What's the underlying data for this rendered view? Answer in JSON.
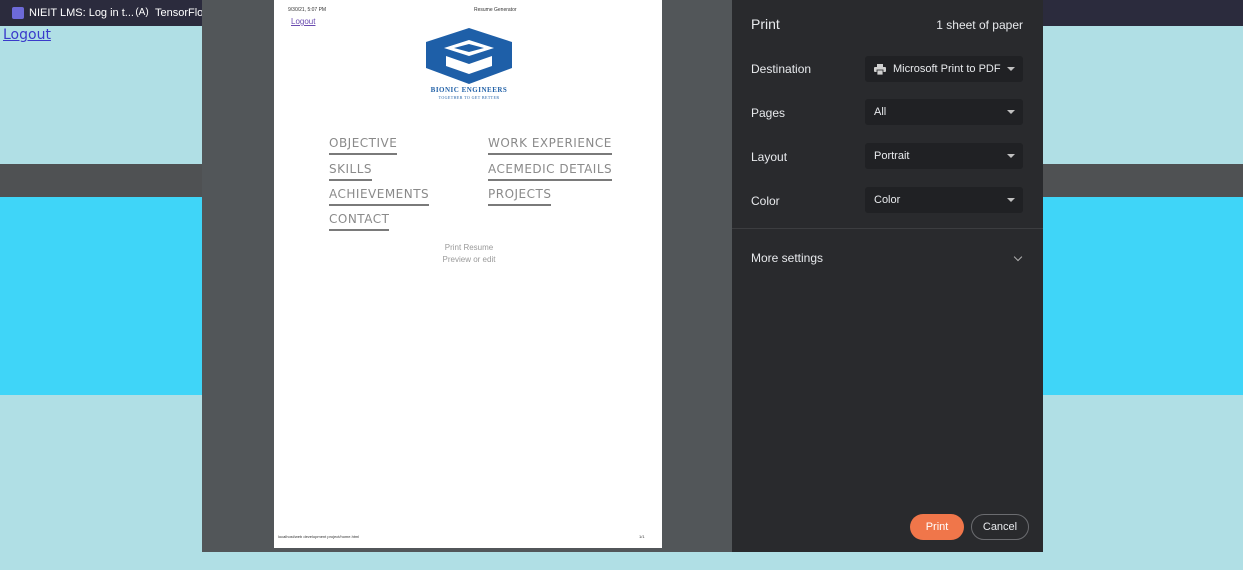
{
  "bookmarks": [
    {
      "label": "NIEIT LMS: Log in t...",
      "icon": "lms-favicon-icon"
    },
    {
      "label": "TensorFlow",
      "icon": "tensorflow-icon"
    }
  ],
  "background_page": {
    "logout": "Logout"
  },
  "preview": {
    "header_date": "9/30/21, 5:07 PM",
    "header_title": "Resume Generator",
    "logout": "Logout",
    "brand_name": "BIONIC ENGINEERS",
    "brand_tagline": "TOGETHER TO GET BETTER",
    "nav_left": [
      "OBJECTIVE",
      "SKILLS",
      "ACHIEVEMENTS",
      "CONTACT"
    ],
    "nav_right": [
      "WORK EXPERIENCE",
      "ACEMEDIC DETAILS",
      "PROJECTS"
    ],
    "print_resume": "Print Resume",
    "preview_or_edit": "Preview or edit",
    "footer_url": "localhost/web development project/home.html",
    "footer_page": "1/1"
  },
  "print_panel": {
    "title": "Print",
    "sheets": "1 sheet of paper",
    "destination_label": "Destination",
    "destination_value": "Microsoft Print to PDF",
    "pages_label": "Pages",
    "pages_value": "All",
    "layout_label": "Layout",
    "layout_value": "Portrait",
    "color_label": "Color",
    "color_value": "Color",
    "more_settings": "More settings",
    "print_button": "Print",
    "cancel_button": "Cancel",
    "accent_color": "#f0764a"
  }
}
